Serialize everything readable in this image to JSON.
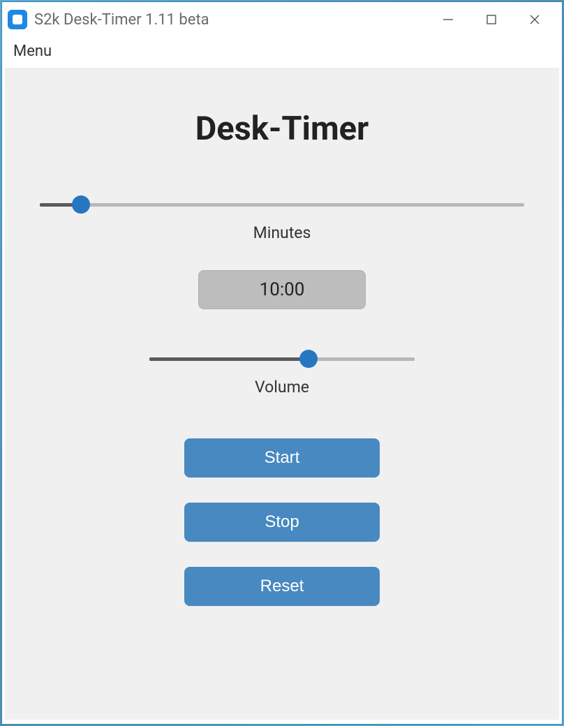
{
  "window": {
    "title": "S2k Desk-Timer 1.11 beta"
  },
  "menubar": {
    "menu_label": "Menu"
  },
  "main": {
    "heading": "Desk-Timer",
    "minutes": {
      "label": "Minutes",
      "percent": 8.5
    },
    "time_display": "10:00",
    "volume": {
      "label": "Volume",
      "percent": 60
    },
    "buttons": {
      "start": "Start",
      "stop": "Stop",
      "reset": "Reset"
    }
  },
  "colors": {
    "accent": "#2776c2",
    "button_bg": "#4789c0",
    "content_bg": "#f0f0f0"
  }
}
